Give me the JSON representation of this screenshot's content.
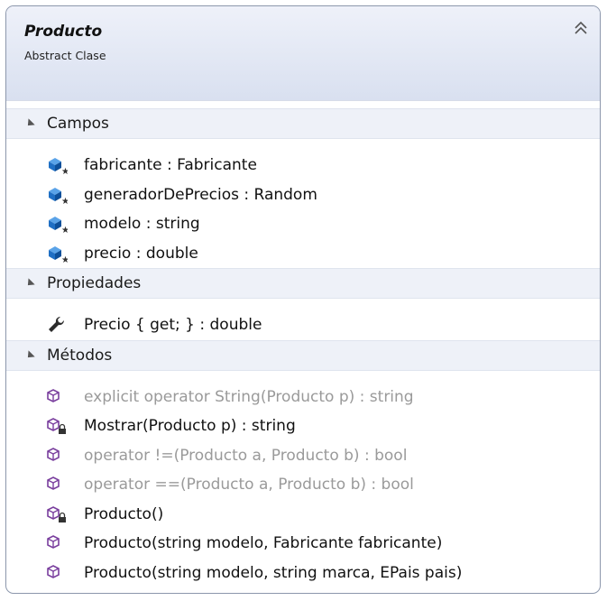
{
  "class": {
    "name": "Producto",
    "kind": "Abstract Clase"
  },
  "sections": {
    "fields": {
      "label": "Campos",
      "items": [
        {
          "text": "fabricante : Fabricante"
        },
        {
          "text": "generadorDePrecios : Random"
        },
        {
          "text": "modelo : string"
        },
        {
          "text": "precio : double"
        }
      ]
    },
    "properties": {
      "label": "Propiedades",
      "items": [
        {
          "text": "Precio { get; } : double"
        }
      ]
    },
    "methods": {
      "label": "Métodos",
      "items": [
        {
          "text": "explicit operator String(Producto p) : string",
          "dim": true
        },
        {
          "text": "Mostrar(Producto p) : string",
          "dim": false,
          "protected": true
        },
        {
          "text": "operator !=(Producto a, Producto b) : bool",
          "dim": true
        },
        {
          "text": "operator ==(Producto a, Producto b) : bool",
          "dim": true
        },
        {
          "text": "Producto()",
          "dim": false,
          "protected": true
        },
        {
          "text": "Producto(string modelo, Fabricante fabricante)",
          "dim": false
        },
        {
          "text": "Producto(string modelo, string marca, EPais pais)",
          "dim": false
        }
      ]
    }
  },
  "colors": {
    "field_icon": "#1f6fc4",
    "method_icon": "#7a3f9e",
    "dim_text": "#9a9a9a"
  },
  "icons": {
    "field": "field-icon",
    "property": "wrench-icon",
    "method": "method-icon"
  }
}
